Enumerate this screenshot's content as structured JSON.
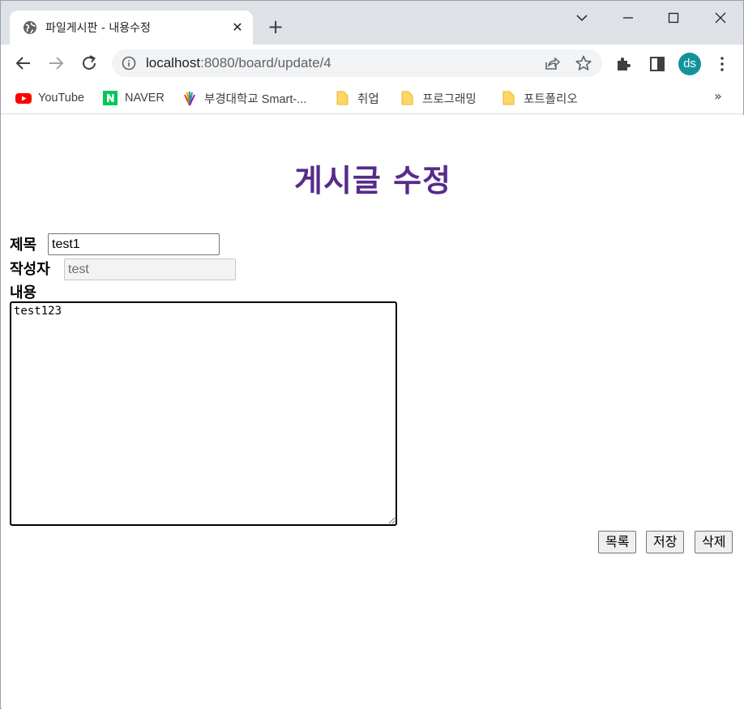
{
  "browser": {
    "tab_title": "파일게시판 - 내용수정",
    "url_host": "localhost",
    "url_rest": ":8080/board/update/4",
    "profile_initials": "ds",
    "bookmarks": [
      {
        "label": "YouTube",
        "icon": "youtube-icon"
      },
      {
        "label": "NAVER",
        "icon": "naver-icon"
      },
      {
        "label": "부경대학교 Smart-...",
        "icon": "pknu-icon"
      },
      {
        "label": "취업",
        "icon": "folder-icon"
      },
      {
        "label": "프로그래밍",
        "icon": "folder-icon"
      },
      {
        "label": "포트폴리오",
        "icon": "folder-icon"
      }
    ],
    "bookmarks_more": "»"
  },
  "page": {
    "title": "게시글 수정",
    "title_label": "제목",
    "title_value": "test1",
    "author_label": "작성자",
    "author_value": "test",
    "content_label": "내용",
    "content_value": "test123",
    "buttons": {
      "list": "목록",
      "save": "저장",
      "delete": "삭제"
    },
    "colors": {
      "title": "#562b8c"
    }
  }
}
